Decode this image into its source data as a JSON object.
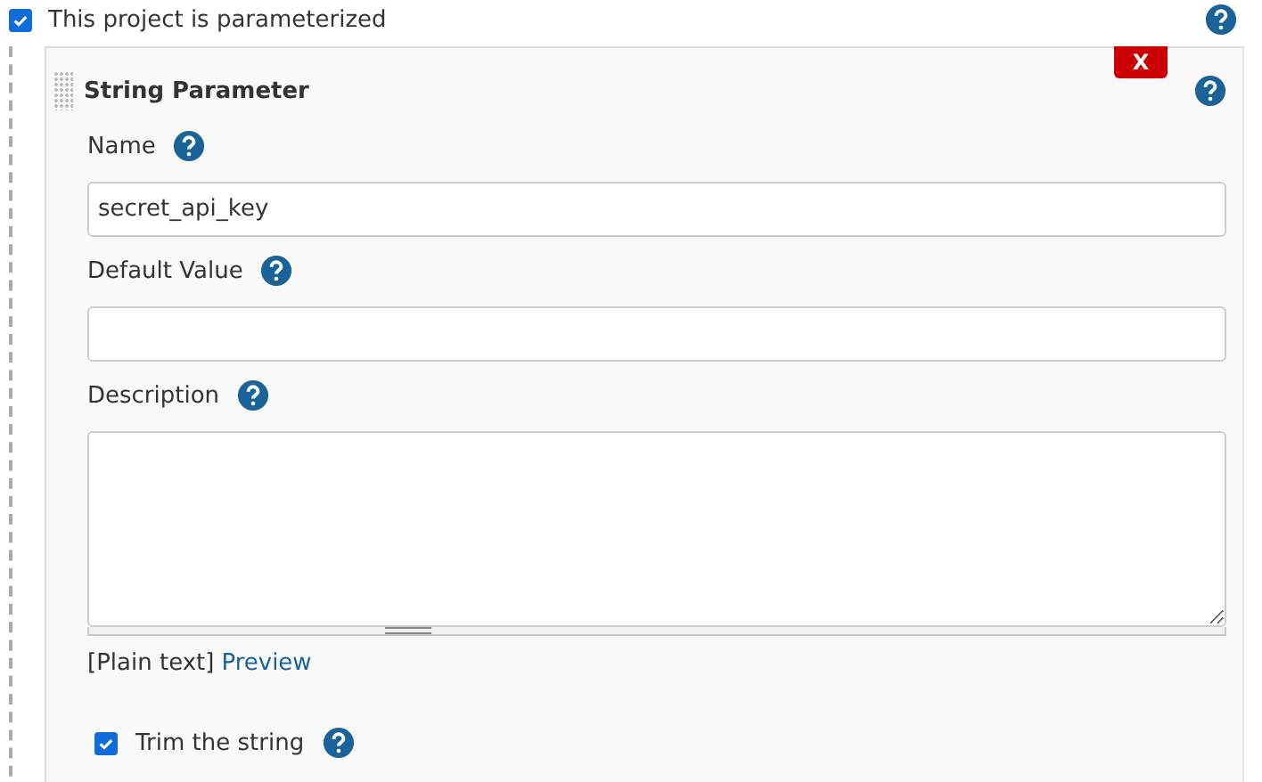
{
  "project_option": {
    "label": "This project is parameterized",
    "checked": true
  },
  "parameter": {
    "title": "String Parameter",
    "delete_label": "X",
    "fields": [
      {
        "kind": "input",
        "label": "Name",
        "value": "secret_api_key"
      },
      {
        "kind": "input",
        "label": "Default Value"
      },
      {
        "kind": "textarea",
        "label": "Description"
      }
    ],
    "format_note": "[Plain text]",
    "preview_link": "Preview",
    "trim_option": {
      "label": "Trim the string",
      "checked": true
    }
  }
}
